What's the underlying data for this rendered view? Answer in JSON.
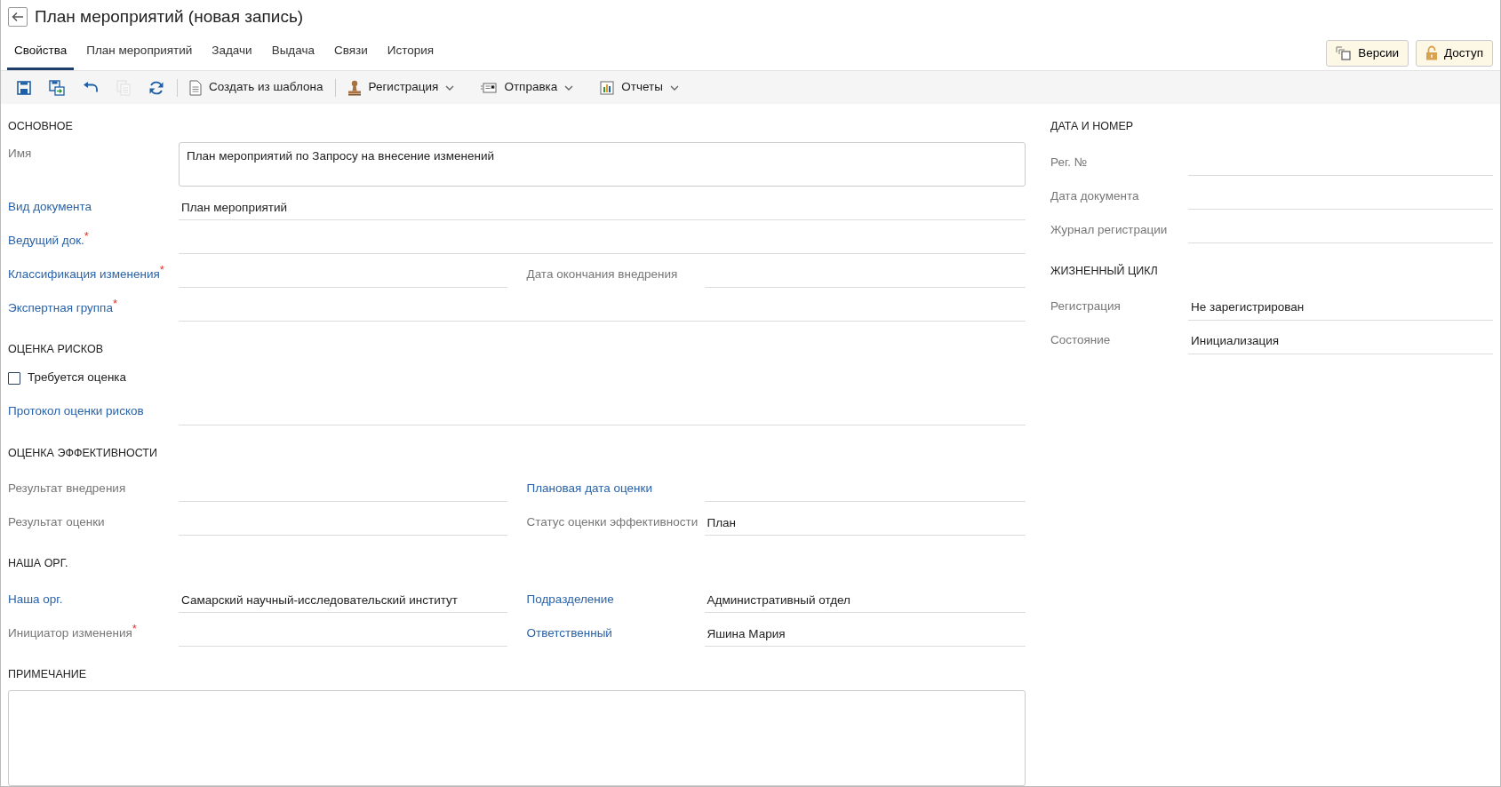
{
  "title": "План мероприятий (новая запись)",
  "tabs": [
    {
      "label": "Свойства",
      "selected": true
    },
    {
      "label": "План мероприятий",
      "selected": false
    },
    {
      "label": "Задачи",
      "selected": false
    },
    {
      "label": "Выдача",
      "selected": false
    },
    {
      "label": "Связи",
      "selected": false
    },
    {
      "label": "История",
      "selected": false
    }
  ],
  "header_buttons": [
    {
      "kind": "versions",
      "label": "Версии"
    },
    {
      "kind": "access",
      "label": "Доступ"
    }
  ],
  "toolbar": [
    {
      "kind": "save"
    },
    {
      "kind": "save-as"
    },
    {
      "kind": "undo"
    },
    {
      "kind": "copy",
      "disabled": true
    },
    {
      "kind": "refresh"
    },
    {
      "kind": "separator"
    },
    {
      "kind": "template",
      "label": "Создать из шаблона"
    },
    {
      "kind": "separator"
    },
    {
      "kind": "register",
      "label": "Регистрация",
      "dropdown": true
    },
    {
      "kind": "send",
      "label": "Отправка",
      "dropdown": true
    },
    {
      "kind": "reports",
      "label": "Отчеты",
      "dropdown": true
    }
  ],
  "left_sections": [
    {
      "title": "ОСНОВНОЕ",
      "rows": [
        {
          "kind": "multiline",
          "fields": [
            {
              "label": "Имя",
              "link": false,
              "value": "План мероприятий по Запросу на внесение изменений"
            }
          ]
        },
        {
          "kind": "line",
          "fields": [
            {
              "label": "Вид документа",
              "link": true,
              "value": "План мероприятий"
            }
          ]
        },
        {
          "kind": "line",
          "fields": [
            {
              "label": "Ведущий док.",
              "link": true,
              "required_mark": "*"
            }
          ]
        },
        {
          "kind": "line",
          "fields": [
            {
              "label": "Классификация изменения",
              "link": true,
              "required_mark": "*"
            },
            {
              "label": "Дата окончания внедрения",
              "link": false
            }
          ]
        },
        {
          "kind": "line",
          "fields": [
            {
              "label": "Экспертная группа",
              "link": true,
              "required_mark": "*"
            }
          ]
        }
      ]
    },
    {
      "title": "ОЦЕНКА РИСКОВ",
      "rows": [
        {
          "kind": "checkbox",
          "label": "Требуется оценка",
          "checked": false
        },
        {
          "kind": "line",
          "fields": [
            {
              "label": "Протокол оценки рисков",
              "link": true
            }
          ]
        }
      ]
    },
    {
      "title": "ОЦЕНКА ЭФФЕКТИВНОСТИ",
      "rows": [
        {
          "kind": "line",
          "fields": [
            {
              "label": "Результат внедрения",
              "link": false
            },
            {
              "label": "Плановая дата оценки",
              "link": true
            }
          ]
        },
        {
          "kind": "line",
          "fields": [
            {
              "label": "Результат оценки",
              "link": false
            },
            {
              "label": "Статус оценки эффективности",
              "link": false,
              "value": "План"
            }
          ]
        }
      ]
    },
    {
      "title": "НАША ОРГ.",
      "rows": [
        {
          "kind": "line",
          "fields": [
            {
              "label": "Наша орг.",
              "link": true,
              "value": "Самарский научный-исследовательский институт"
            },
            {
              "label": "Подразделение",
              "link": true,
              "value": "Административный отдел"
            }
          ]
        },
        {
          "kind": "line",
          "fields": [
            {
              "label": "Инициатор изменения",
              "link": false,
              "required_mark": "*"
            },
            {
              "label": "Ответственный",
              "link": true,
              "value": "Яшина Мария"
            }
          ]
        }
      ]
    },
    {
      "title": "ПРИМЕЧАНИЕ",
      "rows": [
        {
          "kind": "note"
        }
      ]
    }
  ],
  "right_sections": [
    {
      "title": "ДАТА И НОМЕР",
      "rows": [
        {
          "kind": "line",
          "fields": [
            {
              "label": "Рег. №",
              "link": false
            }
          ]
        },
        {
          "kind": "line",
          "fields": [
            {
              "label": "Дата документа",
              "link": false
            }
          ]
        },
        {
          "kind": "line",
          "fields": [
            {
              "label": "Журнал регистрации",
              "link": false
            }
          ]
        }
      ]
    },
    {
      "title": "ЖИЗНЕННЫЙ ЦИКЛ",
      "rows": [
        {
          "kind": "line",
          "fields": [
            {
              "label": "Регистрация",
              "link": false,
              "value": "Не зарегистрирован"
            }
          ]
        },
        {
          "kind": "line",
          "fields": [
            {
              "label": "Состояние",
              "link": false,
              "value": "Инициализация"
            }
          ]
        }
      ]
    }
  ]
}
